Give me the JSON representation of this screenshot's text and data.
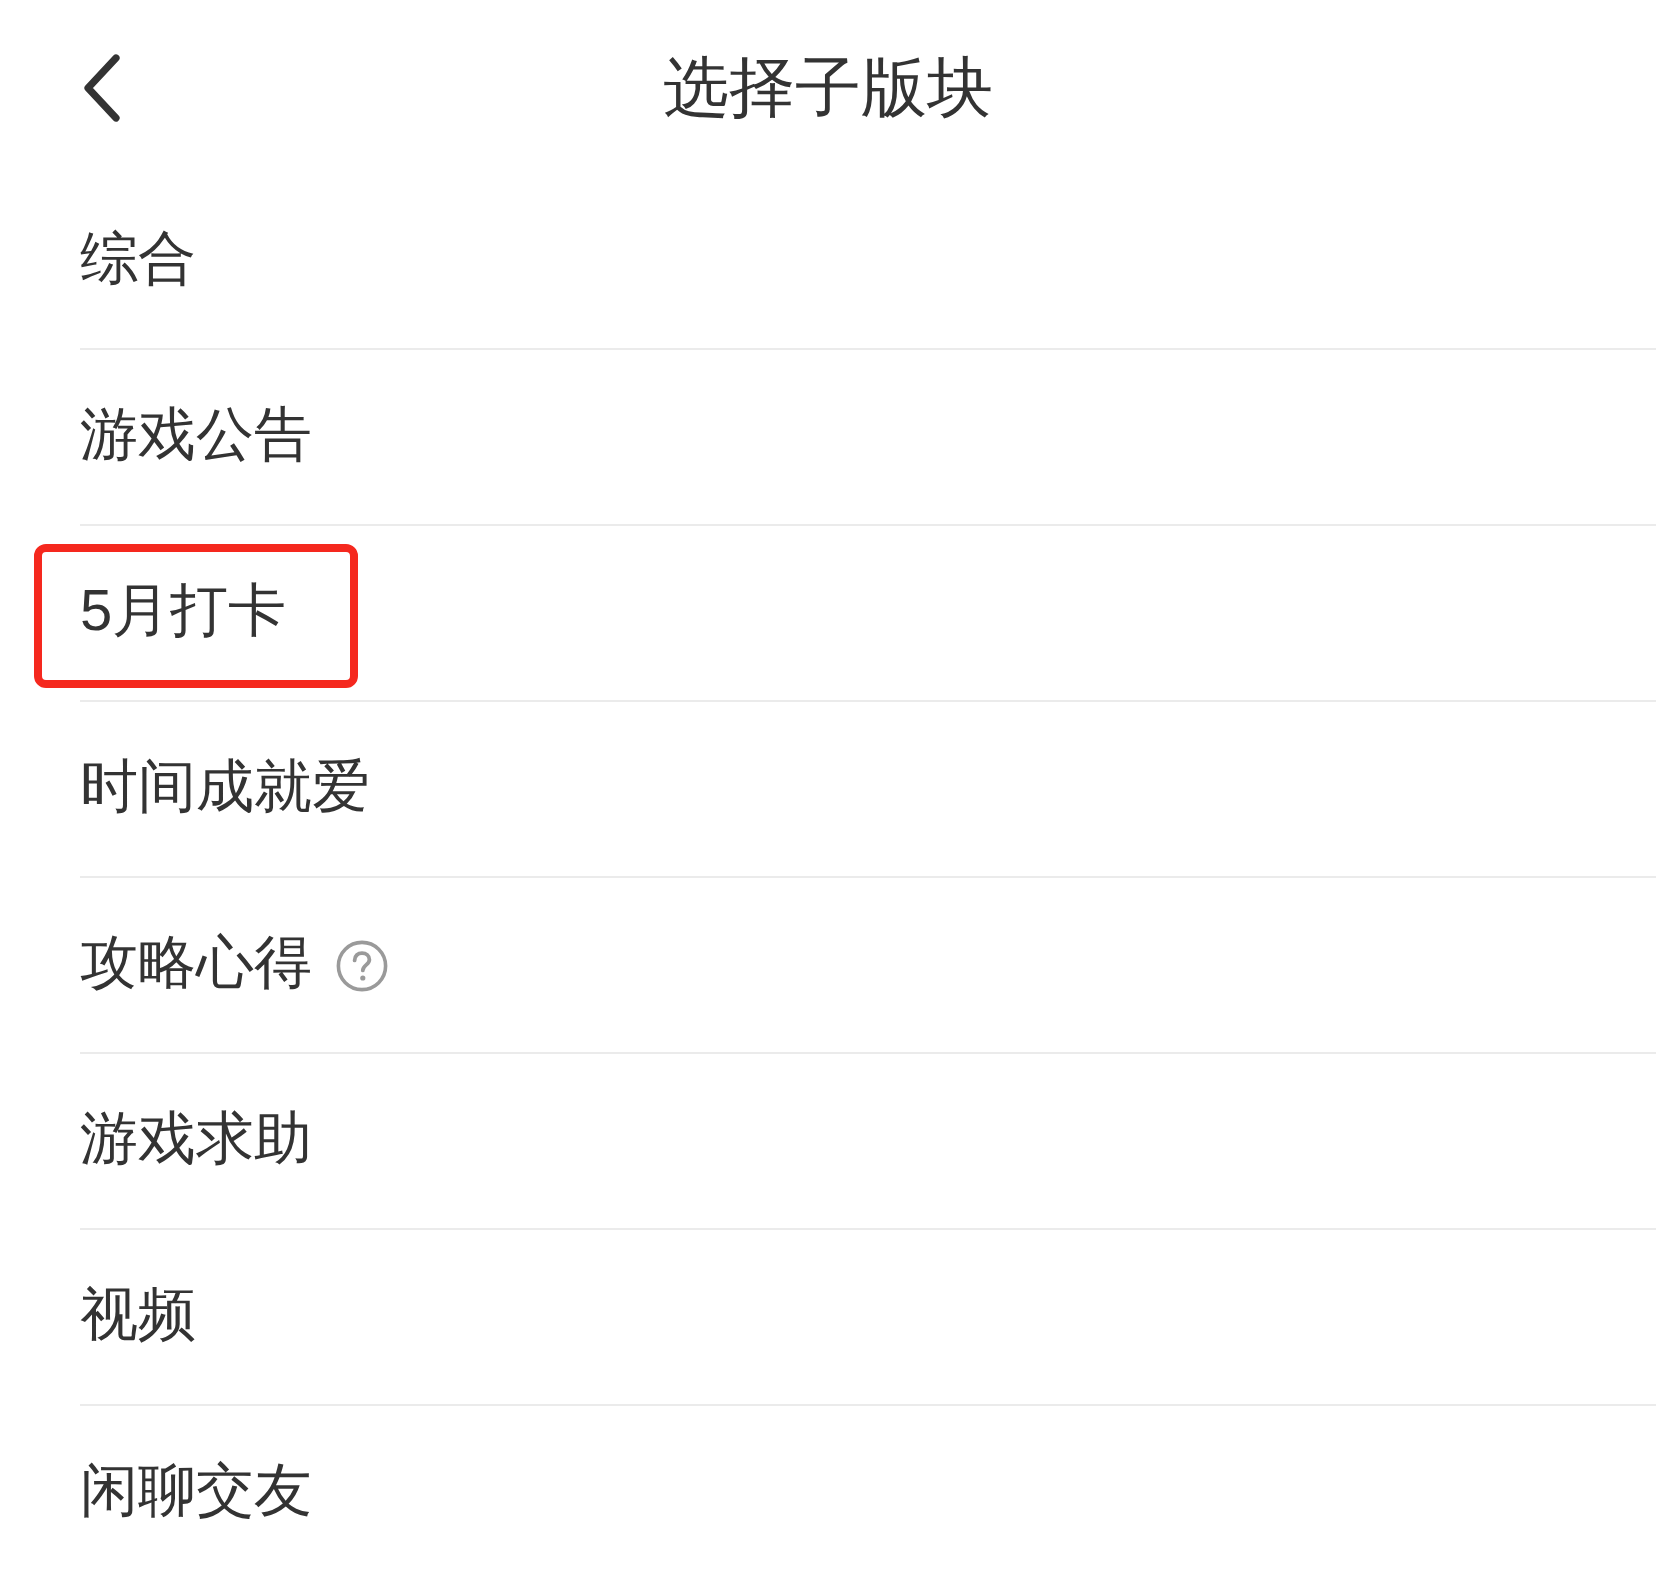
{
  "header": {
    "title": "选择子版块"
  },
  "items": [
    {
      "label": "综合",
      "highlighted": false,
      "help_icon": false
    },
    {
      "label": "游戏公告",
      "highlighted": false,
      "help_icon": false
    },
    {
      "label": "5月打卡",
      "highlighted": true,
      "help_icon": false
    },
    {
      "label": "时间成就爱",
      "highlighted": false,
      "help_icon": false
    },
    {
      "label": "攻略心得",
      "highlighted": false,
      "help_icon": true
    },
    {
      "label": "游戏求助",
      "highlighted": false,
      "help_icon": false
    },
    {
      "label": "视频",
      "highlighted": false,
      "help_icon": false
    },
    {
      "label": "闲聊交友",
      "highlighted": false,
      "help_icon": false
    }
  ]
}
